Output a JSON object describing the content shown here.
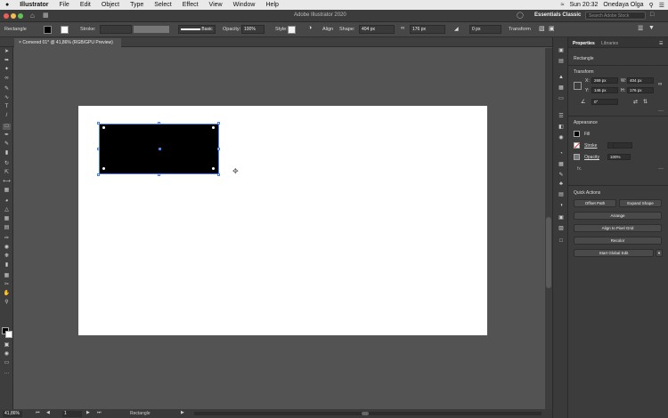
{
  "menubar": {
    "apple": "",
    "app": "Illustrator",
    "items": [
      "File",
      "Edit",
      "Object",
      "Type",
      "Select",
      "Effect",
      "View",
      "Window",
      "Help"
    ],
    "clock": "Sun 20:32",
    "user": "Onedaya Olga"
  },
  "titlebar": {
    "title": "Adobe Illustrator 2020",
    "workspace": "Essentials Classic",
    "search_placeholder": "Search Adobe Stock"
  },
  "controlbar": {
    "object_type": "Rectangle",
    "stroke_label": "Stroke:",
    "stroke_style": "Basic",
    "opacity_label": "Opacity:",
    "opacity_value": "100%",
    "style_label": "Style:",
    "align_label": "Align",
    "shape_label": "Shape:",
    "shape_width": "404 px",
    "shape_height": "176 px",
    "corner_value": "0 px",
    "transform_label": "Transform"
  },
  "document": {
    "tab_title": "Cornered 01* @ 41,86% (RGB/GPU Preview)"
  },
  "statusbar": {
    "zoom": "41,86%",
    "page": "1",
    "tool_name": "Rectangle"
  },
  "panel": {
    "tabs": [
      "Properties",
      "Libraries"
    ],
    "selection": "Rectangle",
    "transform_heading": "Transform",
    "x_label": "X:",
    "x_value": "269 px",
    "w_label": "W:",
    "w_value": "404 px",
    "y_label": "Y:",
    "y_value": "146 px",
    "h_label": "H:",
    "h_value": "176 px",
    "angle_value": "0°",
    "appearance_heading": "Appearance",
    "fill_label": "Fill",
    "stroke_label": "Stroke",
    "opacity_label": "Opacity",
    "opacity_value": "100%",
    "fx_label": "fx.",
    "quick_actions_heading": "Quick Actions",
    "buttons": {
      "offset_path": "Offset Path",
      "expand_shape": "Expand Shape",
      "arrange": "Arrange",
      "align_pixel": "Align to Pixel Grid",
      "recolor": "Recolor",
      "global_edit": "Start Global Edit"
    }
  },
  "colors": {
    "selection": "#4a7df0",
    "fill": "#000000",
    "artboard": "#ffffff"
  }
}
